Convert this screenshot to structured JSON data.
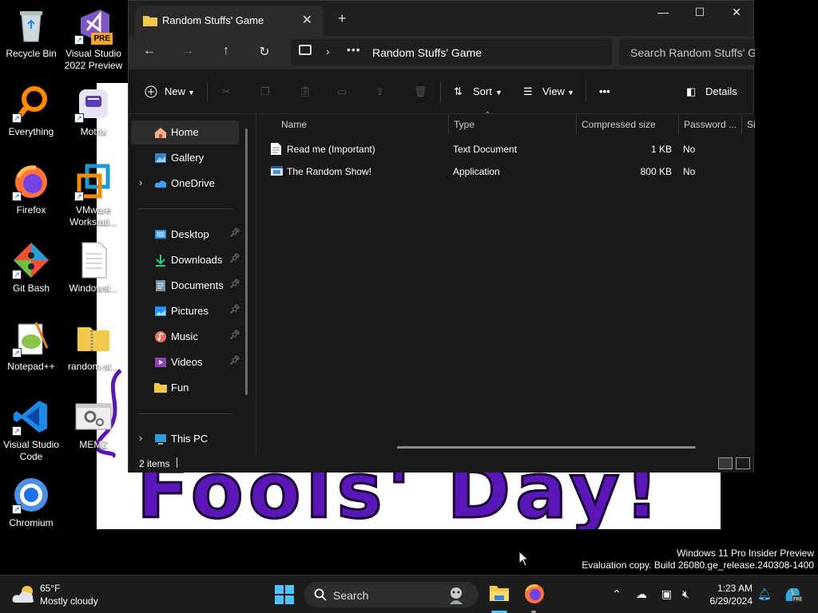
{
  "desktop": {
    "icons": [
      {
        "label": "Recycle Bin",
        "icon": "recycle-bin-icon"
      },
      {
        "label": "Visual Studio 2022 Preview",
        "icon": "visual-studio-preview-icon",
        "badge": "PRE"
      },
      {
        "label": "Everything",
        "icon": "everything-search-icon"
      },
      {
        "label": "Motrix",
        "icon": "motrix-icon"
      },
      {
        "label": "Firefox",
        "icon": "firefox-icon"
      },
      {
        "label": "VMware Workstati...",
        "icon": "vmware-icon"
      },
      {
        "label": "Git Bash",
        "icon": "git-bash-icon"
      },
      {
        "label": "Windowsl...",
        "icon": "text-file-icon"
      },
      {
        "label": "Notepad++",
        "icon": "notepad-plus-plus-icon"
      },
      {
        "label": "random-st...",
        "icon": "zip-folder-icon"
      },
      {
        "label": "Visual Studio Code",
        "icon": "vscode-icon"
      },
      {
        "label": "MEMZ",
        "icon": "settings-app-icon"
      },
      {
        "label": "Chromium",
        "icon": "chromium-icon"
      }
    ],
    "wallpaper_text": "Fools' Day!"
  },
  "explorer": {
    "tab_title": "Random Stuffs' Game",
    "address": "Random Stuffs' Game",
    "search_placeholder": "Search Random Stuffs' Game",
    "toolbar": {
      "new_label": "New",
      "sort_label": "Sort",
      "view_label": "View",
      "more_label": "•••",
      "details_label": "Details"
    },
    "nav": {
      "home": "Home",
      "gallery": "Gallery",
      "onedrive": "OneDrive",
      "desktop": "Desktop",
      "downloads": "Downloads",
      "documents": "Documents",
      "pictures": "Pictures",
      "music": "Music",
      "videos": "Videos",
      "fun": "Fun",
      "thispc": "This PC"
    },
    "columns": {
      "name": "Name",
      "type": "Type",
      "compressed": "Compressed size",
      "password": "Password ...",
      "size": "Si"
    },
    "files": [
      {
        "name": "Read me (Important)",
        "type": "Text Document",
        "compressed": "1 KB",
        "password": "No",
        "icon": "text-document-icon"
      },
      {
        "name": "The Random Show!",
        "type": "Application",
        "compressed": "800 KB",
        "password": "No",
        "icon": "application-icon"
      }
    ],
    "status": "2 items"
  },
  "watermark": {
    "line1": "Windows 11 Pro Insider Preview",
    "line2": "Evaluation copy. Build 26080.ge_release.240308-1400"
  },
  "taskbar": {
    "weather_temp": "65°F",
    "weather_cond": "Mostly cloudy",
    "search_label": "Search",
    "time": "1:23 AM",
    "date": "6/29/2024"
  },
  "colors": {
    "accent": "#4cc2ff",
    "wallpaper_text": "#5b16b8",
    "window_bg": "#191919"
  }
}
